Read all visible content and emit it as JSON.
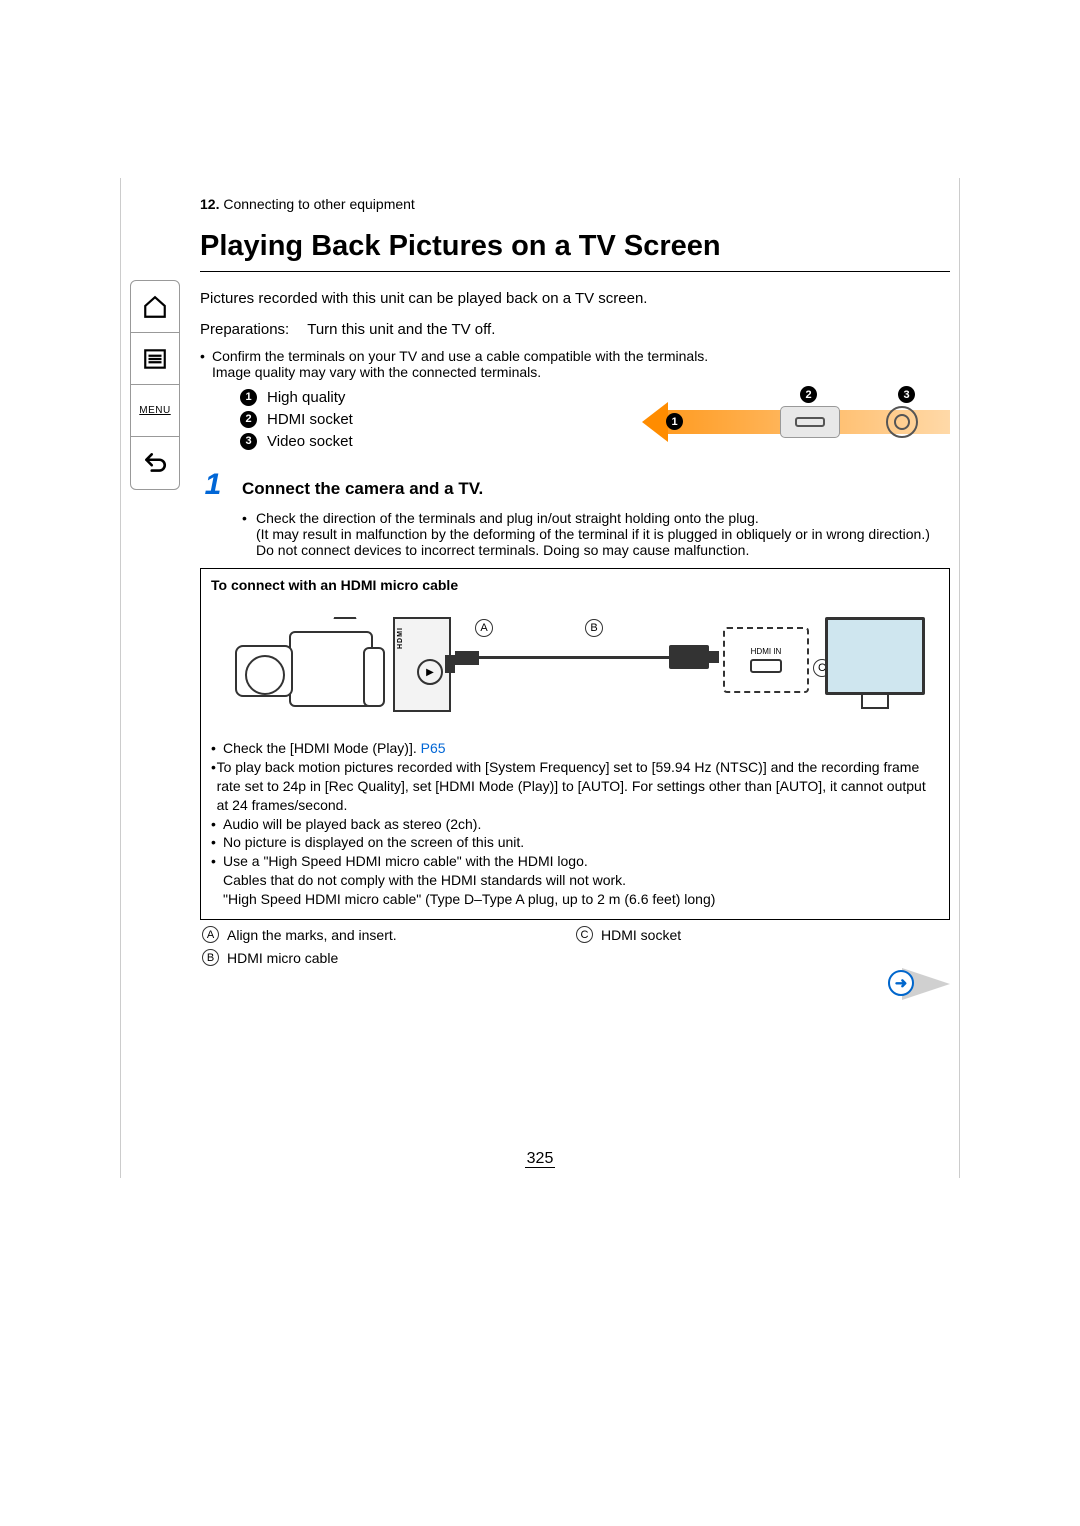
{
  "breadcrumb": {
    "chapter": "12.",
    "title": "Connecting to other equipment"
  },
  "heading": "Playing Back Pictures on a TV Screen",
  "intro": "Pictures recorded with this unit can be played back on a TV screen.",
  "prep_label": "Preparations:",
  "prep_text": "Turn this unit and the TV off.",
  "confirm_l1": "Confirm the terminals on your TV and use a cable compatible with the terminals.",
  "confirm_l2": "Image quality may vary with the connected terminals.",
  "quality": {
    "n1": "1",
    "t1": "High quality",
    "n2": "2",
    "t2": "HDMI socket",
    "n3": "3",
    "t3": "Video socket"
  },
  "step": {
    "num": "1",
    "title": "Connect the camera and a TV.",
    "b1": "Check the direction of the terminals and plug in/out straight holding onto the plug.",
    "b2": "(It may result in malfunction by the deforming of the terminal if it is plugged in obliquely or in wrong direction.)",
    "b3": "Do not connect devices to incorrect terminals. Doing so may cause malfunction."
  },
  "box": {
    "title": "To connect with an HDMI micro cable",
    "A": "A",
    "B": "B",
    "C": "C",
    "hdmi_in": "HDMI IN",
    "hdmi_side": "HDMI"
  },
  "notes": {
    "n1a": "Check the [HDMI Mode (Play)]. ",
    "n1b": "P65",
    "n2": "To play back motion pictures recorded with [System Frequency] set to [59.94 Hz (NTSC)] and the recording frame rate set to 24p in [Rec Quality], set [HDMI Mode (Play)] to [AUTO]. For settings other than [AUTO], it cannot output at 24 frames/second.",
    "n3": "Audio will be played back as stereo (2ch).",
    "n4": "No picture is displayed on the screen of this unit.",
    "n5": "Use a \"High Speed HDMI micro cable\" with the HDMI logo.",
    "n6": "Cables that do not comply with the HDMI standards will not work.",
    "n7": "\"High Speed HDMI micro cable\" (Type D–Type A plug, up to 2 m (6.6 feet) long)"
  },
  "legend": {
    "A": "A",
    "A_t": "Align the marks, and insert.",
    "B": "B",
    "B_t": "HDMI micro cable",
    "C": "C",
    "C_t": "HDMI socket"
  },
  "sidebar": {
    "menu": "MENU"
  },
  "continue_glyph": "➜",
  "page_number": "325"
}
